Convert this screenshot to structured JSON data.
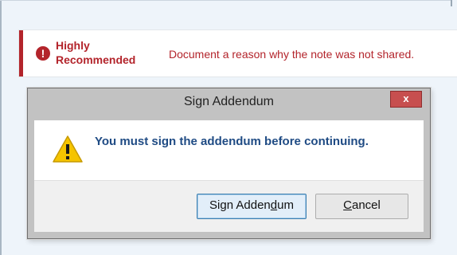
{
  "alert": {
    "icon": "exclamation-circle-icon",
    "title": "Highly Recommended",
    "message": "Document a reason why the note was not shared.",
    "color": "#b3242b"
  },
  "dialog": {
    "title": "Sign Addendum",
    "close_label": "x",
    "warning_icon": "warning-triangle-icon",
    "message": "You must sign the addendum before continuing.",
    "buttons": {
      "sign_label_prefix": "Sign Adden",
      "sign_label_mnemonic": "d",
      "sign_label_suffix": "um",
      "cancel_label_mnemonic": "C",
      "cancel_label_suffix": "ancel"
    },
    "colors": {
      "message": "#1f4b84",
      "close_button": "#c74f4f",
      "focus_border": "#3c7fb1"
    }
  }
}
